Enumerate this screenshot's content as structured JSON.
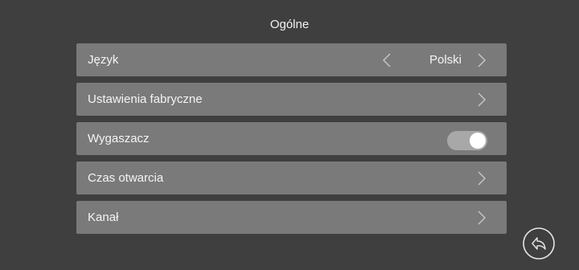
{
  "header": {
    "title": "Ogólne"
  },
  "menu": {
    "items": [
      {
        "label": "Język",
        "value": "Polski",
        "icon": "chevron-right-icon"
      },
      {
        "label": "Ustawienia fabryczne",
        "icon": "chevron-right-icon"
      },
      {
        "label": "Wygaszacz",
        "toggle_state": "on"
      },
      {
        "label": "Czas otwarcia",
        "icon": "chevron-right-icon"
      },
      {
        "label": "Kanał",
        "icon": "chevron-right-icon"
      }
    ]
  },
  "footer": {
    "back_icon": "back-arrow-icon"
  },
  "colors": {
    "background": "#3f3f3f",
    "row": "#7a7a7a",
    "text": "#f4f4f4",
    "toggle_track": "#a8a8a8",
    "toggle_knob": "#ffffff"
  }
}
